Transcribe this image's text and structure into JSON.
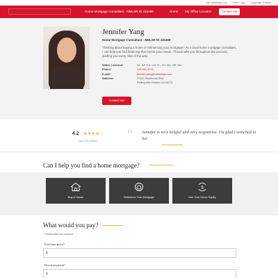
{
  "top_links": [
    "Visit wellsfargo.com",
    "Client Login",
    "Language: English"
  ],
  "navbar": {
    "brand_text": "Home Mortgage Consultant · NMLSR ID 415488",
    "nav_items": [
      "Home",
      "My Office Location"
    ],
    "contact_button": "Contact me"
  },
  "profile": {
    "name": "Jennifer Yang",
    "role": "Home Mortgage Consultant · NMLSR ID 415488",
    "bio": "Thinking about buying a home or refinancing your mortgage? As a local home mortgage consultant, I can help you find financing that meets your needs. I'll work with you throughout the process, guiding you every step of the way.",
    "details": [
      {
        "label": "States Licensed:",
        "value": "AK, AZ, CA, CO, FL, NV, NM, OR, WA"
      },
      {
        "label": "Phone:",
        "value": "310-951-2076"
      },
      {
        "label": "E-mail:",
        "value": "jennifer.yang@wellsfargo.com"
      },
      {
        "label": "Address:",
        "value": "27440 Hawthorne Blvd"
      },
      {
        "label": "",
        "value": "Rolling Hills Estates CA 90274"
      }
    ],
    "contact_button": "Contact me"
  },
  "rating": {
    "score": "4.2",
    "stars": "★★★★☆",
    "count_text": "out of 15 reviews",
    "quote": "Jennifer is very helpful and very responsive. I'm glad I switched to her"
  },
  "services": {
    "title": "Can I help you find a home mortgage?",
    "cards": [
      {
        "label": "Buy a House",
        "icon": "house-icon"
      },
      {
        "label": "Refinance Your Mortgage",
        "icon": "refinance-icon"
      },
      {
        "label": "Use Your Home Equity",
        "icon": "dollar-cycle-icon"
      }
    ]
  },
  "calculator": {
    "title": "What would you pay?",
    "required_note": "marked field are required",
    "fields": [
      {
        "label": "Purchase price",
        "value": "$"
      },
      {
        "label": "Down payment",
        "value": "$"
      }
    ]
  },
  "colors": {
    "brand_red": "#d6142a",
    "accent_gold": "#f0b33a",
    "card_dark": "#3c3c3c",
    "star": "#f5a623"
  }
}
